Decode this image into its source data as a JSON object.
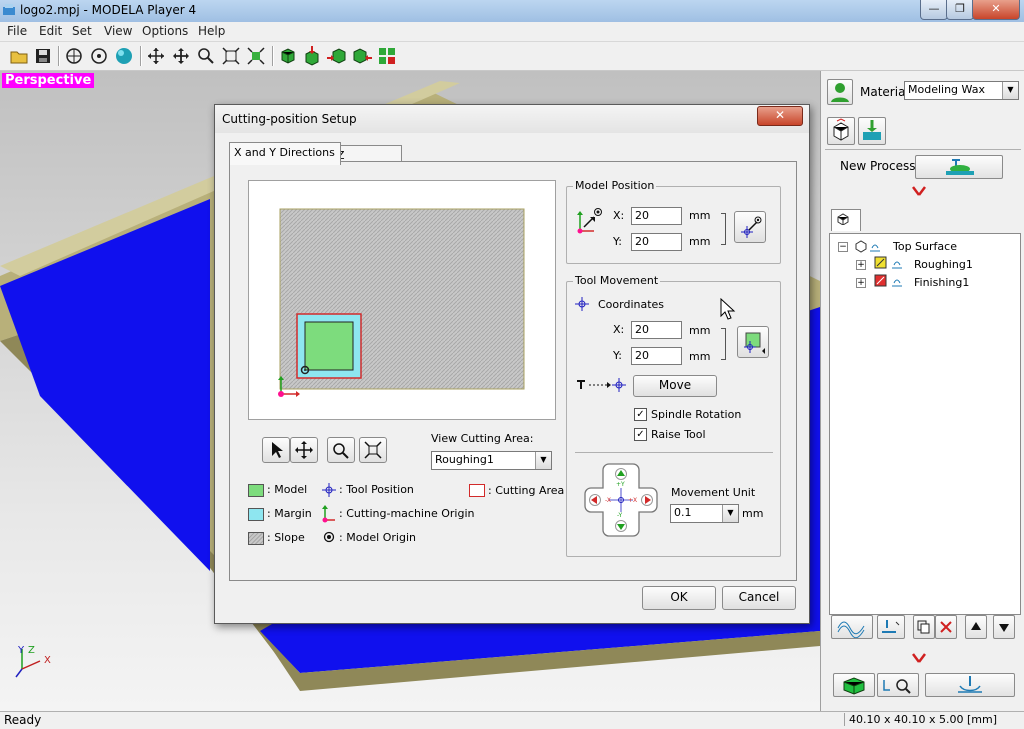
{
  "window": {
    "title": "logo2.mpj - MODELA Player 4",
    "minimize": "—",
    "maximize": "❐",
    "close": "✕"
  },
  "menu": [
    "File",
    "Edit",
    "Set",
    "View",
    "Options",
    "Help"
  ],
  "viewport": {
    "label": "Perspective",
    "axes": {
      "x": "X",
      "y": "Y",
      "z": "Z"
    }
  },
  "right_panel": {
    "material_label": "Material",
    "material_value": "Modeling Wax",
    "new_process_label": "New Process",
    "tree": [
      {
        "label": "Top Surface"
      },
      {
        "label": "Roughing1"
      },
      {
        "label": "Finishing1"
      }
    ]
  },
  "statusbar": {
    "left": "Ready",
    "right": "40.10 x 40.10 x 5.00 [mm]"
  },
  "dialog": {
    "title": "Cutting-position Setup",
    "close": "✕",
    "tabs": [
      "X and Y Directions",
      "Z Direction"
    ],
    "model_position": {
      "title": "Model Position",
      "x_label": "X:",
      "x_value": "20",
      "x_unit": "mm",
      "y_label": "Y:",
      "y_value": "20",
      "y_unit": "mm"
    },
    "tool_movement": {
      "title": "Tool Movement",
      "coordinates_label": "Coordinates",
      "x_label": "X:",
      "x_value": "20",
      "x_unit": "mm",
      "y_label": "Y:",
      "y_value": "20",
      "y_unit": "mm",
      "move_button": "Move",
      "spindle_rotation": "Spindle Rotation",
      "raise_tool": "Raise Tool",
      "check_mark": "✓",
      "movement_unit_label": "Movement Unit",
      "movement_unit_value": "0.1",
      "movement_unit_unit": "mm",
      "pad": {
        "plus_y": "+Y",
        "minus_y": "-Y",
        "minus_x": "-X",
        "plus_x": "+X"
      }
    },
    "view_cutting_area": {
      "label": "View Cutting Area:",
      "value": "Roughing1"
    },
    "legend": {
      "model": ": Model",
      "margin": ": Margin",
      "slope": ": Slope",
      "tool_position": ": Tool Position",
      "machine_origin": ": Cutting-machine Origin",
      "model_origin": ": Model Origin",
      "cutting_area": ": Cutting Area"
    },
    "ok": "OK",
    "cancel": "Cancel"
  },
  "colors": {
    "model_green": "#7ddc7d",
    "margin_cyan": "#8ee6f0",
    "cutting_red": "#d22a2a",
    "workpiece_blue": "#1010ee",
    "wax_khaki": "#b8b07a",
    "accent_magenta": "#ff00ff"
  }
}
